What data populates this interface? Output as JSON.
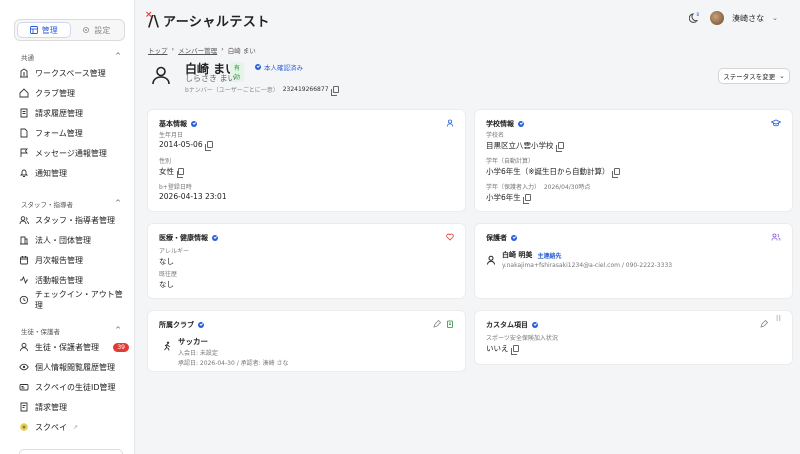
{
  "sidebar": {
    "toggle": {
      "manage_label": "管理",
      "settings_label": "設定"
    },
    "sections": [
      {
        "title": "共通"
      },
      {
        "title": "スタッフ・指導者"
      },
      {
        "title": "生徒・保護者"
      }
    ],
    "items": [
      {
        "label": "ワークスペース管理",
        "icon": "building-icon"
      },
      {
        "label": "クラブ管理",
        "icon": "home-icon"
      },
      {
        "label": "請求履歴管理",
        "icon": "receipt-icon"
      },
      {
        "label": "フォーム管理",
        "icon": "form-icon"
      },
      {
        "label": "メッセージ通報管理",
        "icon": "flag-icon"
      },
      {
        "label": "通知管理",
        "icon": "bell-icon"
      },
      {
        "label": "スタッフ・指導者管理",
        "icon": "users-icon"
      },
      {
        "label": "法人・団体管理",
        "icon": "organization-icon"
      },
      {
        "label": "月次報告管理",
        "icon": "calendar-icon"
      },
      {
        "label": "活動報告管理",
        "icon": "activity-icon"
      },
      {
        "label": "チェックイン・アウト管理",
        "icon": "clock-icon"
      },
      {
        "label": "生徒・保護者管理",
        "icon": "user-icon",
        "badge": "39"
      },
      {
        "label": "個人情報閲覧履歴管理",
        "icon": "eye-icon"
      },
      {
        "label": "スクペイの生徒ID管理",
        "icon": "id-card-icon"
      },
      {
        "label": "請求管理",
        "icon": "invoice-icon"
      },
      {
        "label": "スクペイ",
        "icon": "pay-icon"
      }
    ]
  },
  "header": {
    "app_title": "アーシャルテスト",
    "user_name": "湊崎さな"
  },
  "breadcrumb": [
    "トップ",
    "メンバー管理",
    "白崎 まい"
  ],
  "profile": {
    "name": "白崎 まい",
    "status": "有効",
    "verified": "本人確認済み",
    "kana": "しらさき まい",
    "number_label": "bナンバー（ユーザーごとに一意）",
    "number_value": "232419266877",
    "status_button": "ステータスを変更"
  },
  "cards": {
    "basic": {
      "title": "基本情報",
      "birth_label": "生年月日",
      "birth_value": "2014-05-06",
      "gender_label": "性別",
      "gender_value": "女性",
      "registered_label": "b+登録日時",
      "registered_value": "2026-04-13 23:01"
    },
    "school": {
      "title": "学校情報",
      "school_label": "学校名",
      "school_value": "目黒区立八雲小学校",
      "grade_auto_label": "学年（自動計算）",
      "grade_auto_value": "小学6年生（※誕生日から自動計算）",
      "grade_guardian_label": "学年（保護者入力）",
      "grade_guardian_date": "2026/04/30時点",
      "grade_guardian_value": "小学6年生"
    },
    "medical": {
      "title": "医療・健康情報",
      "allergy_label": "アレルギー",
      "allergy_value": "なし",
      "history_label": "既往歴",
      "history_value": "なし"
    },
    "guardian": {
      "title": "保護者",
      "name": "白崎 明美",
      "tag": "主連絡先",
      "contact": "y.nakajima+fshirasaki1234@a-ciel.com / 090-2222-3333"
    },
    "club": {
      "title": "所属クラブ",
      "club_name": "サッカー",
      "enroll_date": "入会日: 未設定",
      "approval": "承認日: 2026-04-30 / 承認者: 湊崎 さな"
    },
    "custom": {
      "title": "カスタム項目",
      "field_label": "スポーツ安全保険加入状況",
      "field_value": "いいえ"
    }
  },
  "colors": {
    "accent": "#2a5fd6",
    "danger": "#e53935",
    "success": "#2c8a3f"
  }
}
